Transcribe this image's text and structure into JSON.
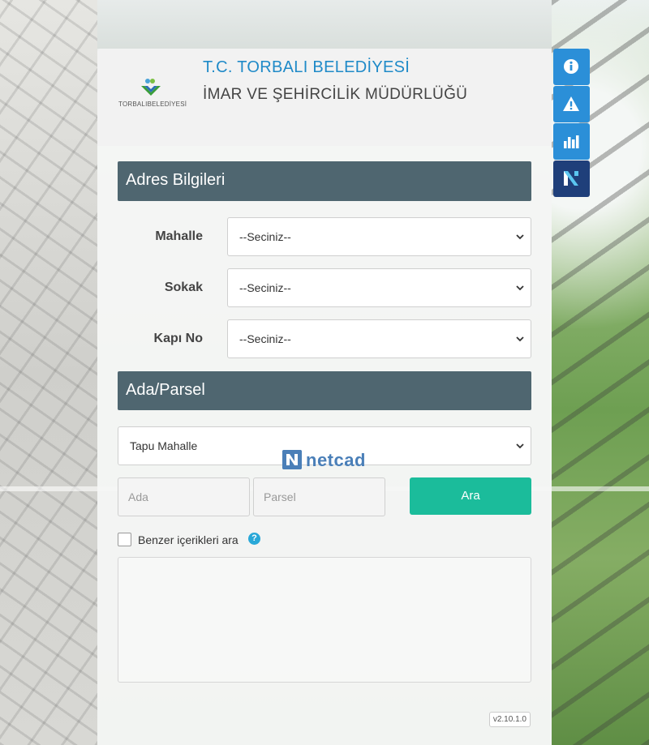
{
  "header": {
    "title": "T.C. TORBALI BELEDİYESİ",
    "subtitle": "İMAR VE ŞEHİRCİLİK MÜDÜRLÜĞÜ",
    "logo_text": "TORBALIBELEDİYESİ"
  },
  "adres": {
    "heading": "Adres Bilgileri",
    "mahalle_label": "Mahalle",
    "mahalle_value": "--Seciniz--",
    "sokak_label": "Sokak",
    "sokak_value": "--Seciniz--",
    "kapino_label": "Kapı No",
    "kapino_value": "--Seciniz--"
  },
  "ada_parsel": {
    "heading": "Ada/Parsel",
    "tapu_mahalle_value": "Tapu Mahalle",
    "ada_placeholder": "Ada",
    "parsel_placeholder": "Parsel",
    "search_label": "Ara"
  },
  "watermark": {
    "text": "netcad"
  },
  "options": {
    "similar_label": "Benzer içerikleri ara",
    "help_glyph": "?"
  },
  "footer": {
    "version": "v2.10.1.0"
  },
  "colors": {
    "accent": "#1f8ac8",
    "section": "#4f6670",
    "button": "#1bbc9b",
    "toolbar": "#2b8fd8",
    "toolbar_dark": "#1f3f7a"
  },
  "toolbar": {
    "icons": [
      "info-icon",
      "warning-icon",
      "chart-icon",
      "netcad-logo-icon"
    ]
  }
}
